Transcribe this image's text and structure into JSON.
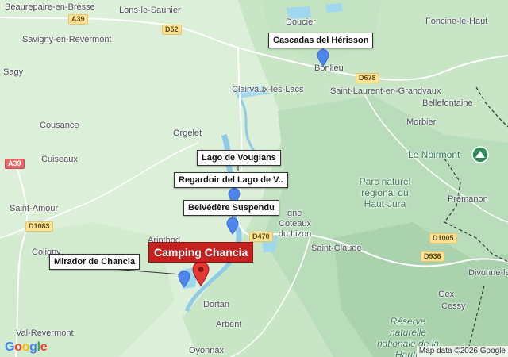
{
  "map": {
    "places": {
      "beaurepaire": "Beaurepaire-en-Bresse",
      "lons": "Lons-le-Saunier",
      "doucier": "Doucier",
      "foncine": "Foncine-le-Haut",
      "savigny": "Savigny-en-Revermont",
      "bonlieu": "Bonlieu",
      "sagy": "Sagy",
      "clairvaux": "Clairvaux-les-Lacs",
      "saint_laurent": "Saint-Laurent-en-Grandvaux",
      "bellefontaine": "Bellefontaine",
      "cousance": "Cousance",
      "orgelet": "Orgelet",
      "morbier": "Morbier",
      "le_noirmont": "Le Noirmont",
      "cuiseaux": "Cuiseaux",
      "premanon": "Prémanon",
      "saint_amour": "Saint-Amour",
      "moirans": "gne",
      "coteaux": "Coteaux du Lizon",
      "coligny": "Coligny",
      "arinthod": "Arinthod",
      "saint_claude": "Saint-Claude",
      "divonne": "Divonne-les-Ba",
      "gex": "Gex",
      "cessy": "Cessy",
      "dortan": "Dortan",
      "arbent": "Arbent",
      "val_revermont": "Val-Revermont",
      "oyonnax": "Oyonnax"
    },
    "parks": {
      "haut_jura": "Parc naturel régional du Haut-Jura",
      "reserve": "Réserve naturelle nationale de la Haute"
    },
    "roads": {
      "a39_top": "A39",
      "a39_left": "A39",
      "d52": "D52",
      "d678": "D678",
      "d1083": "D1083",
      "d470": "D470",
      "d1005": "D1005",
      "d936": "D936"
    },
    "callouts": {
      "cascadas": "Cascadas del Hérisson",
      "lago": "Lago de Vouglans",
      "regardoir": "Regardoir del Lago de V..",
      "belvedere": "Belvédère Suspendu",
      "mirador": "Mirador de Chancia"
    },
    "highlight": "Camping Chancia",
    "google_logo": "Google",
    "attribution": "Map data ©2026 Google",
    "colors": {
      "land": "#d9ecd6",
      "forest": "#bfe0c0",
      "mountain": "#a9d1ad",
      "water": "#9fd7ee",
      "highlight": "#c5221f",
      "marker_blue": "#4f86ec"
    }
  }
}
